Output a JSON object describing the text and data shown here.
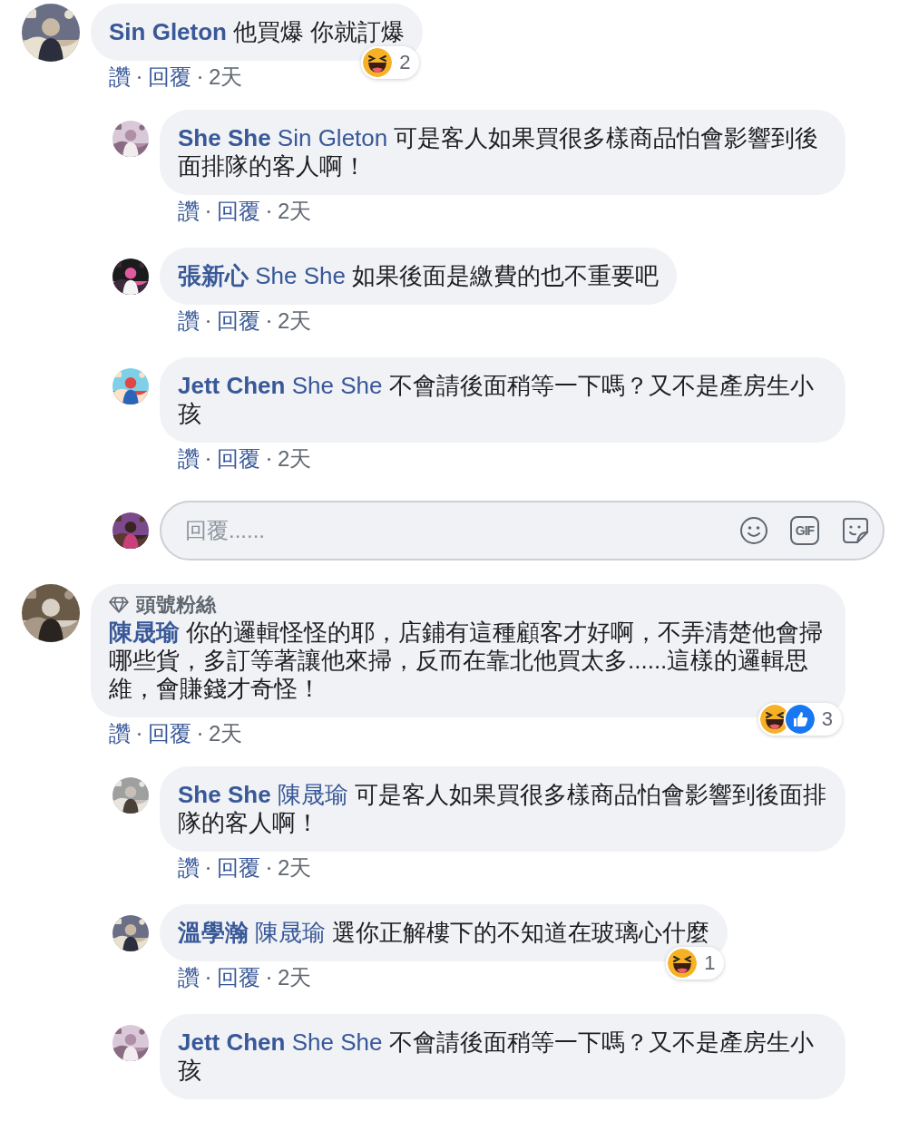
{
  "comments": [
    {
      "author": "Sin Gleton",
      "text": "他買爆 你就訂爆",
      "reactions": {
        "types": [
          {
            "kind": "haha"
          }
        ],
        "count": "2"
      },
      "like_label": "讚",
      "reply_label": "回覆",
      "time": "2天",
      "replies": [
        {
          "author": "She She",
          "mention": "Sin Gleton",
          "text": "可是客人如果買很多樣商品怕會影響到後面排隊的客人啊！",
          "like_label": "讚",
          "reply_label": "回覆",
          "time": "2天"
        },
        {
          "author": "張新心",
          "mention": "She She",
          "text": "如果後面是繳費的也不重要吧",
          "like_label": "讚",
          "reply_label": "回覆",
          "time": "2天"
        },
        {
          "author": "Jett Chen",
          "mention": "She She",
          "text": "不會請後面稍等一下嗎？又不是產房生小孩",
          "like_label": "讚",
          "reply_label": "回覆",
          "time": "2天"
        }
      ],
      "composer": {
        "placeholder": "回覆......",
        "gif_label": "GIF"
      }
    },
    {
      "badge": "頭號粉絲",
      "author": "陳晟瑜",
      "text": "你的邏輯怪怪的耶，店鋪有這種顧客才好啊，不弄清楚他會掃哪些貨，多訂等著讓他來掃，反而在靠北他買太多......這樣的邏輯思維，會賺錢才奇怪！",
      "reactions": {
        "types": [
          {
            "kind": "haha"
          },
          {
            "kind": "like"
          }
        ],
        "count": "3"
      },
      "like_label": "讚",
      "reply_label": "回覆",
      "time": "2天",
      "replies": [
        {
          "author": "She She",
          "mention": "陳晟瑜",
          "text": "可是客人如果買很多樣商品怕會影響到後面排隊的客人啊！",
          "like_label": "讚",
          "reply_label": "回覆",
          "time": "2天"
        },
        {
          "author": "溫學瀚",
          "mention": "陳晟瑜",
          "text": "選你正解樓下的不知道在玻璃心什麼",
          "reactions": {
            "types": [
              {
                "kind": "haha"
              }
            ],
            "count": "1"
          },
          "like_label": "讚",
          "reply_label": "回覆",
          "time": "2天"
        },
        {
          "author": "Jett Chen",
          "mention": "She She",
          "text": "不會請後面稍等一下嗎？又不是產房生小孩"
        }
      ]
    }
  ]
}
